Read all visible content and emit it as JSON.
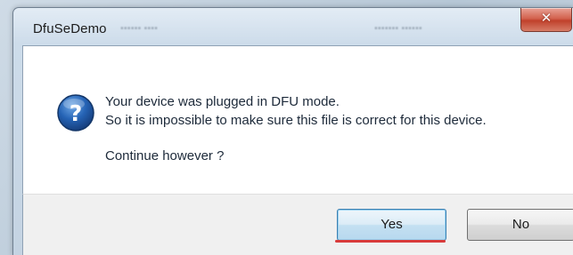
{
  "window": {
    "title": "DfuSeDemo",
    "close_glyph": "✕"
  },
  "dialog": {
    "icon": "question-icon",
    "message_line1": "Your device was plugged in DFU mode.",
    "message_line2": "So it is impossible to make sure this file is correct for this device.",
    "continue_text": "Continue however ?"
  },
  "buttons": {
    "yes_label": "Yes",
    "no_label": "No"
  },
  "colors": {
    "question_icon": "#1f5fae",
    "highlight": "#d83b3b",
    "close_button": "#c0412b"
  }
}
